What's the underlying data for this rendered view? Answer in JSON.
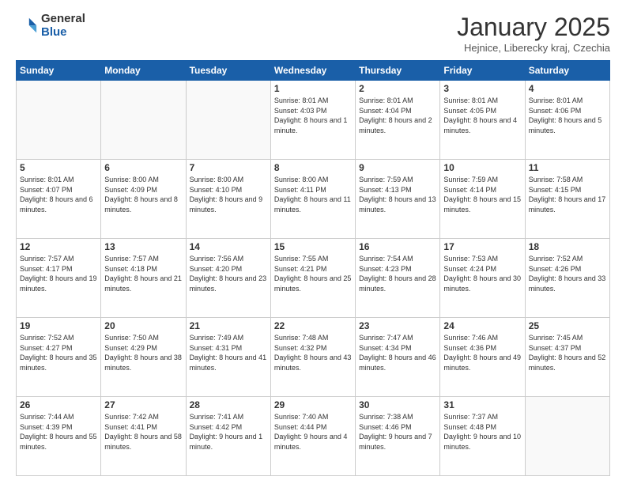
{
  "logo": {
    "general": "General",
    "blue": "Blue"
  },
  "title": "January 2025",
  "location": "Hejnice, Liberecky kraj, Czechia",
  "days_header": [
    "Sunday",
    "Monday",
    "Tuesday",
    "Wednesday",
    "Thursday",
    "Friday",
    "Saturday"
  ],
  "weeks": [
    [
      {
        "day": "",
        "info": ""
      },
      {
        "day": "",
        "info": ""
      },
      {
        "day": "",
        "info": ""
      },
      {
        "day": "1",
        "info": "Sunrise: 8:01 AM\nSunset: 4:03 PM\nDaylight: 8 hours and 1 minute."
      },
      {
        "day": "2",
        "info": "Sunrise: 8:01 AM\nSunset: 4:04 PM\nDaylight: 8 hours and 2 minutes."
      },
      {
        "day": "3",
        "info": "Sunrise: 8:01 AM\nSunset: 4:05 PM\nDaylight: 8 hours and 4 minutes."
      },
      {
        "day": "4",
        "info": "Sunrise: 8:01 AM\nSunset: 4:06 PM\nDaylight: 8 hours and 5 minutes."
      }
    ],
    [
      {
        "day": "5",
        "info": "Sunrise: 8:01 AM\nSunset: 4:07 PM\nDaylight: 8 hours and 6 minutes."
      },
      {
        "day": "6",
        "info": "Sunrise: 8:00 AM\nSunset: 4:09 PM\nDaylight: 8 hours and 8 minutes."
      },
      {
        "day": "7",
        "info": "Sunrise: 8:00 AM\nSunset: 4:10 PM\nDaylight: 8 hours and 9 minutes."
      },
      {
        "day": "8",
        "info": "Sunrise: 8:00 AM\nSunset: 4:11 PM\nDaylight: 8 hours and 11 minutes."
      },
      {
        "day": "9",
        "info": "Sunrise: 7:59 AM\nSunset: 4:13 PM\nDaylight: 8 hours and 13 minutes."
      },
      {
        "day": "10",
        "info": "Sunrise: 7:59 AM\nSunset: 4:14 PM\nDaylight: 8 hours and 15 minutes."
      },
      {
        "day": "11",
        "info": "Sunrise: 7:58 AM\nSunset: 4:15 PM\nDaylight: 8 hours and 17 minutes."
      }
    ],
    [
      {
        "day": "12",
        "info": "Sunrise: 7:57 AM\nSunset: 4:17 PM\nDaylight: 8 hours and 19 minutes."
      },
      {
        "day": "13",
        "info": "Sunrise: 7:57 AM\nSunset: 4:18 PM\nDaylight: 8 hours and 21 minutes."
      },
      {
        "day": "14",
        "info": "Sunrise: 7:56 AM\nSunset: 4:20 PM\nDaylight: 8 hours and 23 minutes."
      },
      {
        "day": "15",
        "info": "Sunrise: 7:55 AM\nSunset: 4:21 PM\nDaylight: 8 hours and 25 minutes."
      },
      {
        "day": "16",
        "info": "Sunrise: 7:54 AM\nSunset: 4:23 PM\nDaylight: 8 hours and 28 minutes."
      },
      {
        "day": "17",
        "info": "Sunrise: 7:53 AM\nSunset: 4:24 PM\nDaylight: 8 hours and 30 minutes."
      },
      {
        "day": "18",
        "info": "Sunrise: 7:52 AM\nSunset: 4:26 PM\nDaylight: 8 hours and 33 minutes."
      }
    ],
    [
      {
        "day": "19",
        "info": "Sunrise: 7:52 AM\nSunset: 4:27 PM\nDaylight: 8 hours and 35 minutes."
      },
      {
        "day": "20",
        "info": "Sunrise: 7:50 AM\nSunset: 4:29 PM\nDaylight: 8 hours and 38 minutes."
      },
      {
        "day": "21",
        "info": "Sunrise: 7:49 AM\nSunset: 4:31 PM\nDaylight: 8 hours and 41 minutes."
      },
      {
        "day": "22",
        "info": "Sunrise: 7:48 AM\nSunset: 4:32 PM\nDaylight: 8 hours and 43 minutes."
      },
      {
        "day": "23",
        "info": "Sunrise: 7:47 AM\nSunset: 4:34 PM\nDaylight: 8 hours and 46 minutes."
      },
      {
        "day": "24",
        "info": "Sunrise: 7:46 AM\nSunset: 4:36 PM\nDaylight: 8 hours and 49 minutes."
      },
      {
        "day": "25",
        "info": "Sunrise: 7:45 AM\nSunset: 4:37 PM\nDaylight: 8 hours and 52 minutes."
      }
    ],
    [
      {
        "day": "26",
        "info": "Sunrise: 7:44 AM\nSunset: 4:39 PM\nDaylight: 8 hours and 55 minutes."
      },
      {
        "day": "27",
        "info": "Sunrise: 7:42 AM\nSunset: 4:41 PM\nDaylight: 8 hours and 58 minutes."
      },
      {
        "day": "28",
        "info": "Sunrise: 7:41 AM\nSunset: 4:42 PM\nDaylight: 9 hours and 1 minute."
      },
      {
        "day": "29",
        "info": "Sunrise: 7:40 AM\nSunset: 4:44 PM\nDaylight: 9 hours and 4 minutes."
      },
      {
        "day": "30",
        "info": "Sunrise: 7:38 AM\nSunset: 4:46 PM\nDaylight: 9 hours and 7 minutes."
      },
      {
        "day": "31",
        "info": "Sunrise: 7:37 AM\nSunset: 4:48 PM\nDaylight: 9 hours and 10 minutes."
      },
      {
        "day": "",
        "info": ""
      }
    ]
  ]
}
